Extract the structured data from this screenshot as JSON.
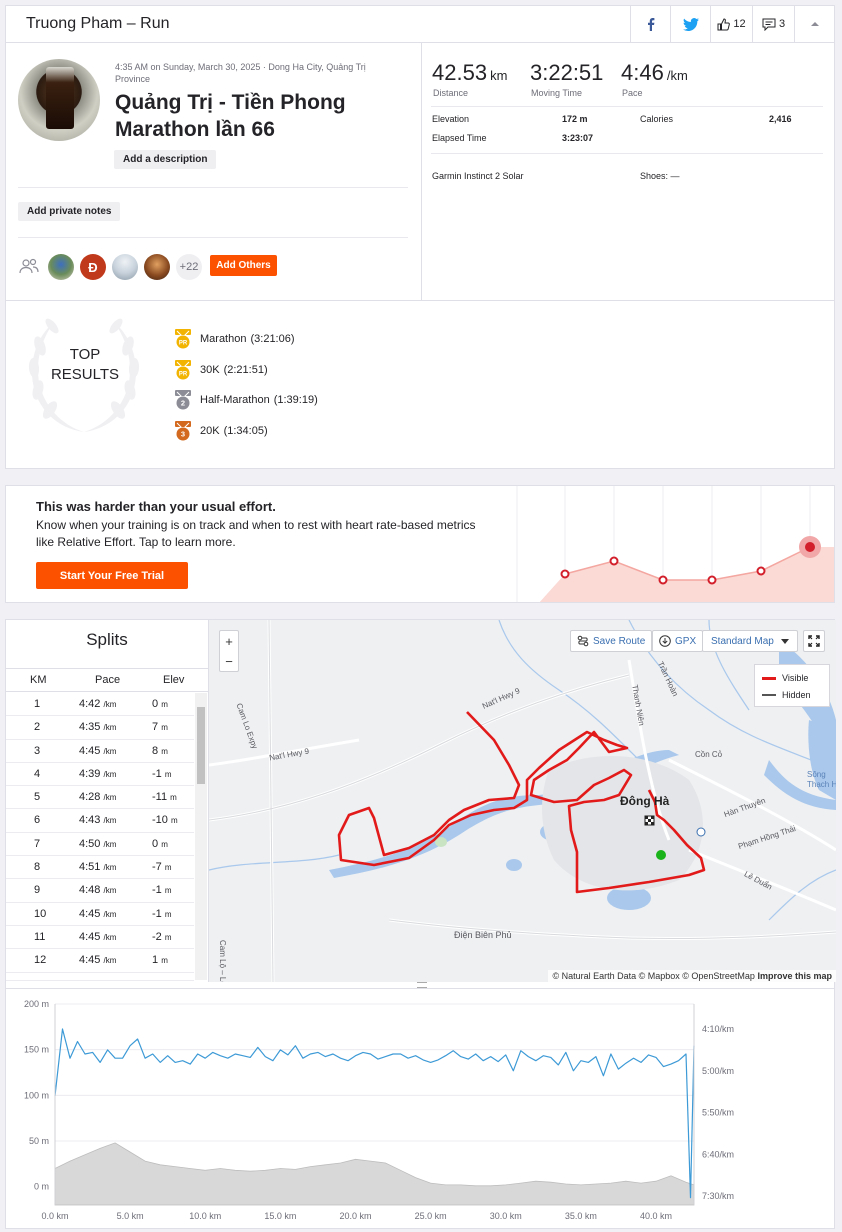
{
  "header": {
    "title": "Truong Pham – Run",
    "kudos_count": "12",
    "comments_count": "3"
  },
  "activity": {
    "meta": "4:35 AM on Sunday, March 30, 2025 · Dong Ha City, Quảng Trị Province",
    "title": "Quảng Trị - Tiền Phong Marathon lần 66",
    "add_description": "Add a description",
    "add_private_notes": "Add private notes",
    "plus_count": "+22",
    "add_others": "Add Others"
  },
  "stats": {
    "distance": {
      "value": "42.53",
      "unit": "km",
      "label": "Distance"
    },
    "moving_time": {
      "value": "3:22:51",
      "label": "Moving Time"
    },
    "pace": {
      "value": "4:46",
      "unit": "/km",
      "label": "Pace"
    },
    "elevation_label": "Elevation",
    "elevation": "172 m",
    "calories_label": "Calories",
    "calories": "2,416",
    "elapsed_label": "Elapsed Time",
    "elapsed": "3:23:07",
    "device": "Garmin Instinct 2 Solar",
    "shoes": "Shoes: —"
  },
  "top_results": {
    "title_line1": "TOP",
    "title_line2": "RESULTS",
    "items": [
      {
        "name": "Marathon",
        "time": "(3:21:06)",
        "medal": "PR",
        "color": "#f2b400"
      },
      {
        "name": "30K",
        "time": "(2:21:51)",
        "medal": "PR",
        "color": "#f2b400"
      },
      {
        "name": "Half-Marathon",
        "time": "(1:39:19)",
        "medal": "2",
        "color": "#8c8c96"
      },
      {
        "name": "20K",
        "time": "(1:34:05)",
        "medal": "3",
        "color": "#d2691e"
      }
    ]
  },
  "effort": {
    "title": "This was harder than your usual effort.",
    "body": "Know when your training is on track and when to rest with heart rate-based metrics like Relative Effort. Tap to learn more.",
    "cta": "Start Your Free Trial"
  },
  "splits": {
    "title": "Splits",
    "headers": [
      "KM",
      "Pace",
      "Elev"
    ],
    "pace_unit": "/km",
    "elev_unit": "m",
    "rows": [
      {
        "km": "1",
        "pace": "4:42",
        "elev": "0"
      },
      {
        "km": "2",
        "pace": "4:35",
        "elev": "7"
      },
      {
        "km": "3",
        "pace": "4:45",
        "elev": "8"
      },
      {
        "km": "4",
        "pace": "4:39",
        "elev": "-1"
      },
      {
        "km": "5",
        "pace": "4:28",
        "elev": "-11"
      },
      {
        "km": "6",
        "pace": "4:43",
        "elev": "-10"
      },
      {
        "km": "7",
        "pace": "4:50",
        "elev": "0"
      },
      {
        "km": "8",
        "pace": "4:51",
        "elev": "-7"
      },
      {
        "km": "9",
        "pace": "4:48",
        "elev": "-1"
      },
      {
        "km": "10",
        "pace": "4:45",
        "elev": "-1"
      },
      {
        "km": "11",
        "pace": "4:45",
        "elev": "-2"
      },
      {
        "km": "12",
        "pace": "4:45",
        "elev": "1"
      }
    ]
  },
  "map": {
    "save_route": "Save Route",
    "gpx": "GPX",
    "map_style": "Standard Map",
    "legend_visible": "Visible",
    "legend_hidden": "Hidden",
    "attribution": "© Natural Earth Data © Mapbox © OpenStreetMap",
    "improve": "Improve this map",
    "labels": {
      "city": "Đông Hà",
      "hwy9a": "Nat'l Hwy 9",
      "hwy9b": "Nat'l Hwy 9",
      "con_co": "Cồn Cỏ",
      "han_thuyen": "Hàn Thuyên",
      "pham_hong_thai": "Phạm Hồng Thái",
      "le_duan": "Lê Duẩn",
      "dien_bien_phu": "Điện Biên Phủ",
      "cam_lo_le_son": "Cam Lộ – Lệ Sơn",
      "cam_lo_expy": "Cam Lo Expy",
      "thanh_nien": "Thanh Niên",
      "tran_hoan": "Trần Hoàn",
      "song": "Sông Thạch Hãn"
    }
  },
  "chart_data": {
    "type": "line",
    "x_ticks": [
      "0.0 km",
      "5.0 km",
      "10.0 km",
      "15.0 km",
      "20.0 km",
      "25.0 km",
      "30.0 km",
      "35.0 km",
      "40.0 km"
    ],
    "y_left_ticks": [
      "200 m",
      "150 m",
      "100 m",
      "50 m",
      "0 m"
    ],
    "y_right_ticks": [
      "4:10/km",
      "5:00/km",
      "5:50/km",
      "6:40/km",
      "7:30/km"
    ],
    "xlim": [
      0,
      42.53
    ],
    "ylim_elev": [
      -20,
      200
    ],
    "colors": {
      "pace": "#3d9ad6",
      "elevation": "#d8d8d8"
    },
    "series": [
      {
        "kind": "elevation",
        "x": [
          0,
          1,
          2,
          3,
          4,
          5,
          6,
          7,
          8,
          9,
          10,
          11,
          12,
          13,
          14,
          15,
          16,
          17,
          18,
          19,
          20,
          21,
          22,
          23,
          24,
          25,
          26,
          27,
          28,
          29,
          30,
          31,
          32,
          33,
          34,
          35,
          36,
          37,
          38,
          39,
          40,
          41,
          42,
          42.53
        ],
        "values": [
          20,
          28,
          35,
          42,
          48,
          38,
          28,
          24,
          22,
          20,
          18,
          20,
          18,
          17,
          18,
          20,
          19,
          22,
          24,
          26,
          30,
          28,
          26,
          18,
          10,
          4,
          2,
          2,
          1,
          1,
          2,
          4,
          6,
          5,
          3,
          2,
          3,
          4,
          6,
          4,
          6,
          12,
          5,
          2
        ]
      },
      {
        "kind": "pace_s_per_km",
        "x": [
          0,
          0.5,
          1,
          1.5,
          2,
          2.5,
          3,
          3.5,
          4,
          4.5,
          5,
          5.5,
          6,
          6.5,
          7,
          7.5,
          8,
          8.5,
          9,
          9.5,
          10,
          10.5,
          11,
          11.5,
          12,
          12.5,
          13,
          13.5,
          14,
          14.5,
          15,
          15.5,
          16,
          16.5,
          17,
          17.5,
          18,
          18.5,
          19,
          19.5,
          20,
          20.5,
          21,
          21.5,
          22,
          22.5,
          23,
          23.5,
          24,
          24.5,
          25,
          25.5,
          26,
          26.5,
          27,
          27.5,
          28,
          28.5,
          29,
          29.5,
          30,
          30.5,
          31,
          31.5,
          32,
          32.5,
          33,
          33.5,
          34,
          34.5,
          35,
          35.5,
          36,
          36.5,
          37,
          37.5,
          38,
          38.5,
          39,
          39.5,
          40,
          40.5,
          41,
          41.5,
          42,
          42.3,
          42.53
        ],
        "values": [
          330,
          250,
          285,
          265,
          280,
          278,
          290,
          275,
          285,
          285,
          270,
          262,
          285,
          280,
          290,
          282,
          290,
          288,
          292,
          280,
          285,
          278,
          282,
          285,
          280,
          282,
          284,
          272,
          283,
          288,
          275,
          281,
          270,
          285,
          280,
          278,
          283,
          280,
          285,
          288,
          282,
          278,
          280,
          286,
          283,
          280,
          280,
          285,
          282,
          287,
          290,
          287,
          282,
          276,
          283,
          286,
          280,
          288,
          283,
          289,
          281,
          300,
          276,
          283,
          288,
          282,
          284,
          293,
          278,
          300,
          288,
          290,
          283,
          306,
          280,
          298,
          291,
          285,
          290,
          281,
          284,
          295,
          292,
          288,
          280,
          452,
          270
        ]
      }
    ]
  }
}
